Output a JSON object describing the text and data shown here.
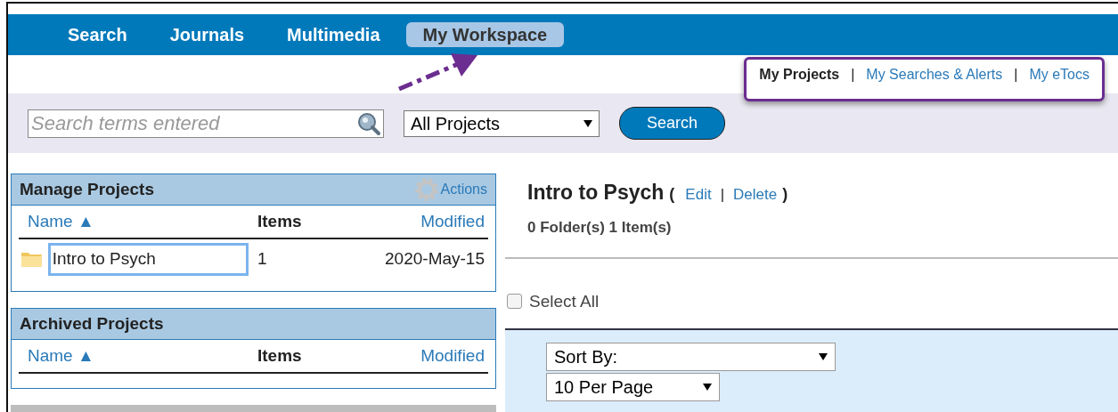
{
  "nav": [
    {
      "label": "Search",
      "selected": false
    },
    {
      "label": "Journals",
      "selected": false
    },
    {
      "label": "Multimedia",
      "selected": false
    },
    {
      "label": "My Workspace",
      "selected": true
    }
  ],
  "sub_nav": {
    "separator": "|",
    "items": [
      {
        "label": "My Projects",
        "selected": true
      },
      {
        "label": "My Searches & Alerts",
        "selected": false
      },
      {
        "label": "My eTocs",
        "selected": false
      }
    ]
  },
  "search_bar": {
    "placeholder": "Search terms entered",
    "scope": "All Projects",
    "button": "Search"
  },
  "manage_projects": {
    "title": "Manage Projects",
    "actions": "Actions",
    "columns": [
      {
        "label": "Name ▲",
        "kind": "link"
      },
      {
        "label": "Items",
        "kind": "plain"
      },
      {
        "label": "Modified",
        "kind": "link"
      }
    ],
    "rows": [
      {
        "name": "Intro to Psych",
        "items": "1",
        "modified": "2020-May-15",
        "selected": true
      }
    ]
  },
  "archived_projects": {
    "title": "Archived Projects",
    "columns": [
      {
        "label": "Name ▲",
        "kind": "link"
      },
      {
        "label": "Items",
        "kind": "plain"
      },
      {
        "label": "Modified",
        "kind": "link"
      }
    ]
  },
  "project": {
    "title": "Intro to Psych",
    "open_paren": "(",
    "edit": "Edit",
    "separator": "|",
    "delete": "Delete",
    "close_paren": ")",
    "counts": "0 Folder(s) 1 Item(s)",
    "select_all": {
      "label": "Select All",
      "checked": false
    },
    "sort_by": "Sort By:",
    "per_page": "10 Per Page"
  }
}
